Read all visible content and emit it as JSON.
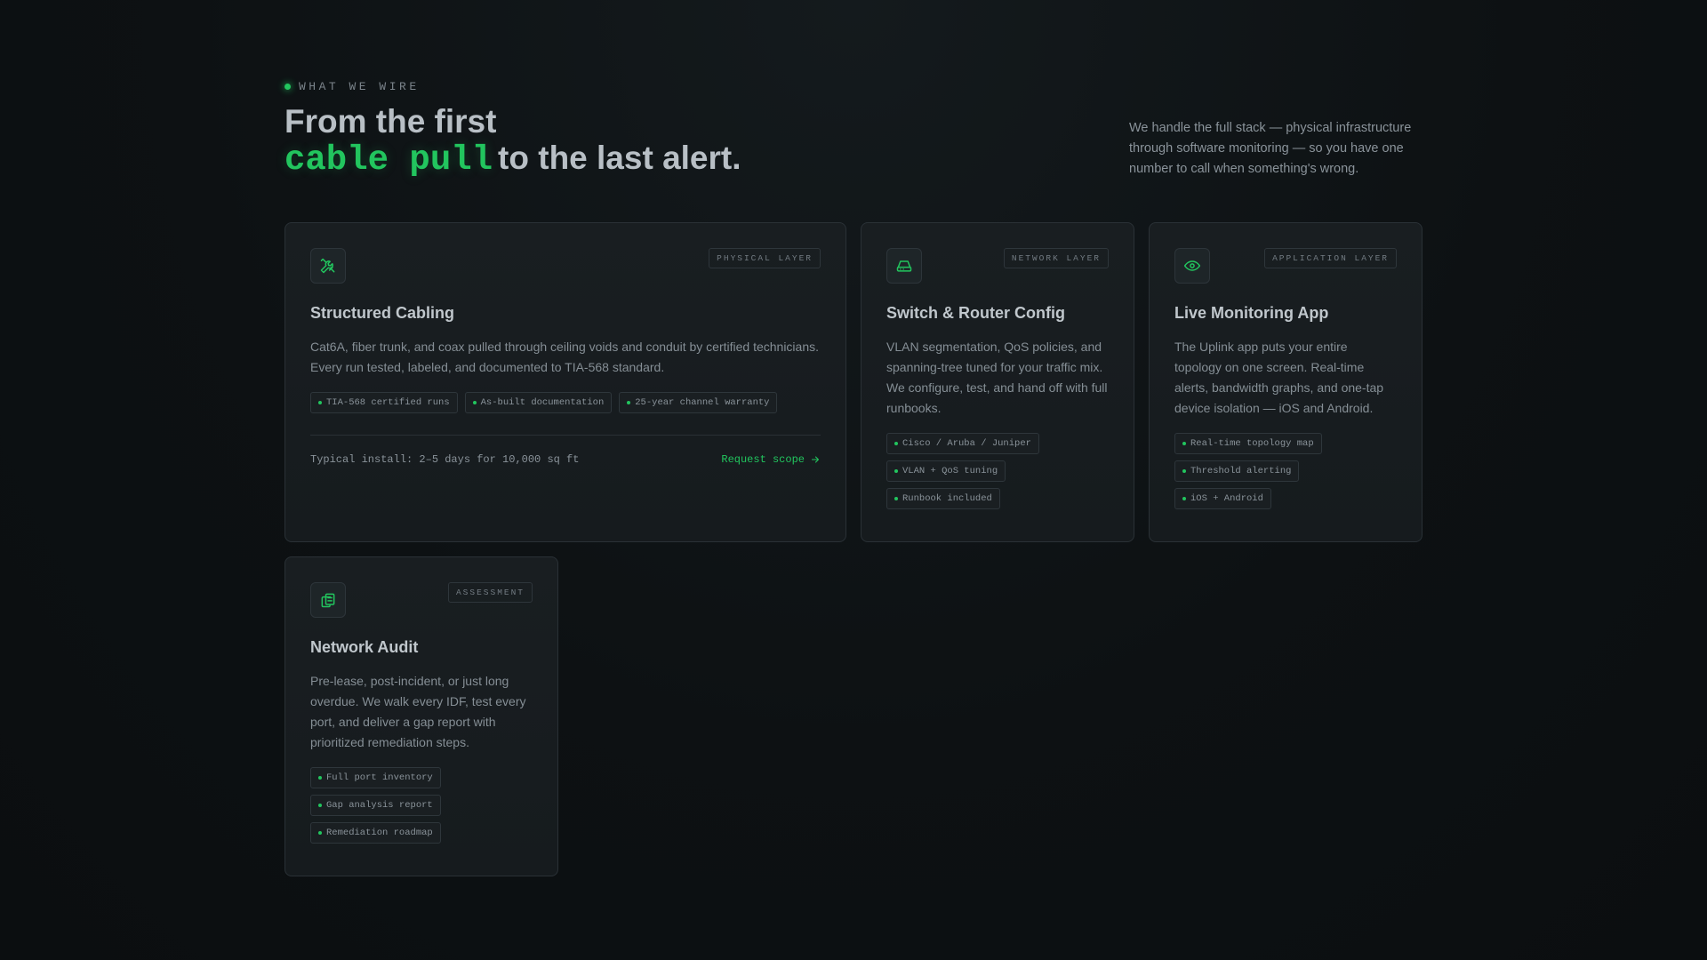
{
  "header": {
    "eyebrow": "WHAT WE WIRE",
    "headline_line1": "From the first",
    "headline_accent": "cable pull",
    "headline_line2_rest": "to the last alert.",
    "intro": "We handle the full stack — physical infrastructure through software monitoring — so you have one number to call when something's wrong."
  },
  "colors": {
    "accent": "#22c55e",
    "background": "#0d1113",
    "card": "#181d20"
  },
  "cards": [
    {
      "icon": "tools-icon",
      "tag": "PHYSICAL LAYER",
      "title": "Structured Cabling",
      "description": "Cat6A, fiber trunk, and coax pulled through ceiling voids and conduit by certified technicians. Every run tested, labeled, and documented to TIA-568 standard.",
      "chips": [
        "TIA-568 certified runs",
        "As-built documentation",
        "25-year channel warranty"
      ],
      "footer_note": "Typical install: 2–5 days for 10,000 sq ft",
      "cta": "Request scope"
    },
    {
      "icon": "router-icon",
      "tag": "NETWORK LAYER",
      "title": "Switch & Router Config",
      "description": "VLAN segmentation, QoS policies, and spanning-tree tuned for your traffic mix. We configure, test, and hand off with full runbooks.",
      "chips": [
        "Cisco / Aruba / Juniper",
        "VLAN + QoS tuning",
        "Runbook included"
      ]
    },
    {
      "icon": "eye-icon",
      "tag": "APPLICATION LAYER",
      "title": "Live Monitoring App",
      "description": "The Uplink app puts your entire topology on one screen. Real-time alerts, bandwidth graphs, and one-tap device isolation — iOS and Android.",
      "chips": [
        "Real-time topology map",
        "Threshold alerting",
        "iOS + Android"
      ]
    },
    {
      "icon": "clipboard-icon",
      "tag": "ASSESSMENT",
      "title": "Network Audit",
      "description": "Pre-lease, post-incident, or just long overdue. We walk every IDF, test every port, and deliver a gap report with prioritized remediation steps.",
      "chips": [
        "Full port inventory",
        "Gap analysis report",
        "Remediation roadmap"
      ]
    }
  ]
}
